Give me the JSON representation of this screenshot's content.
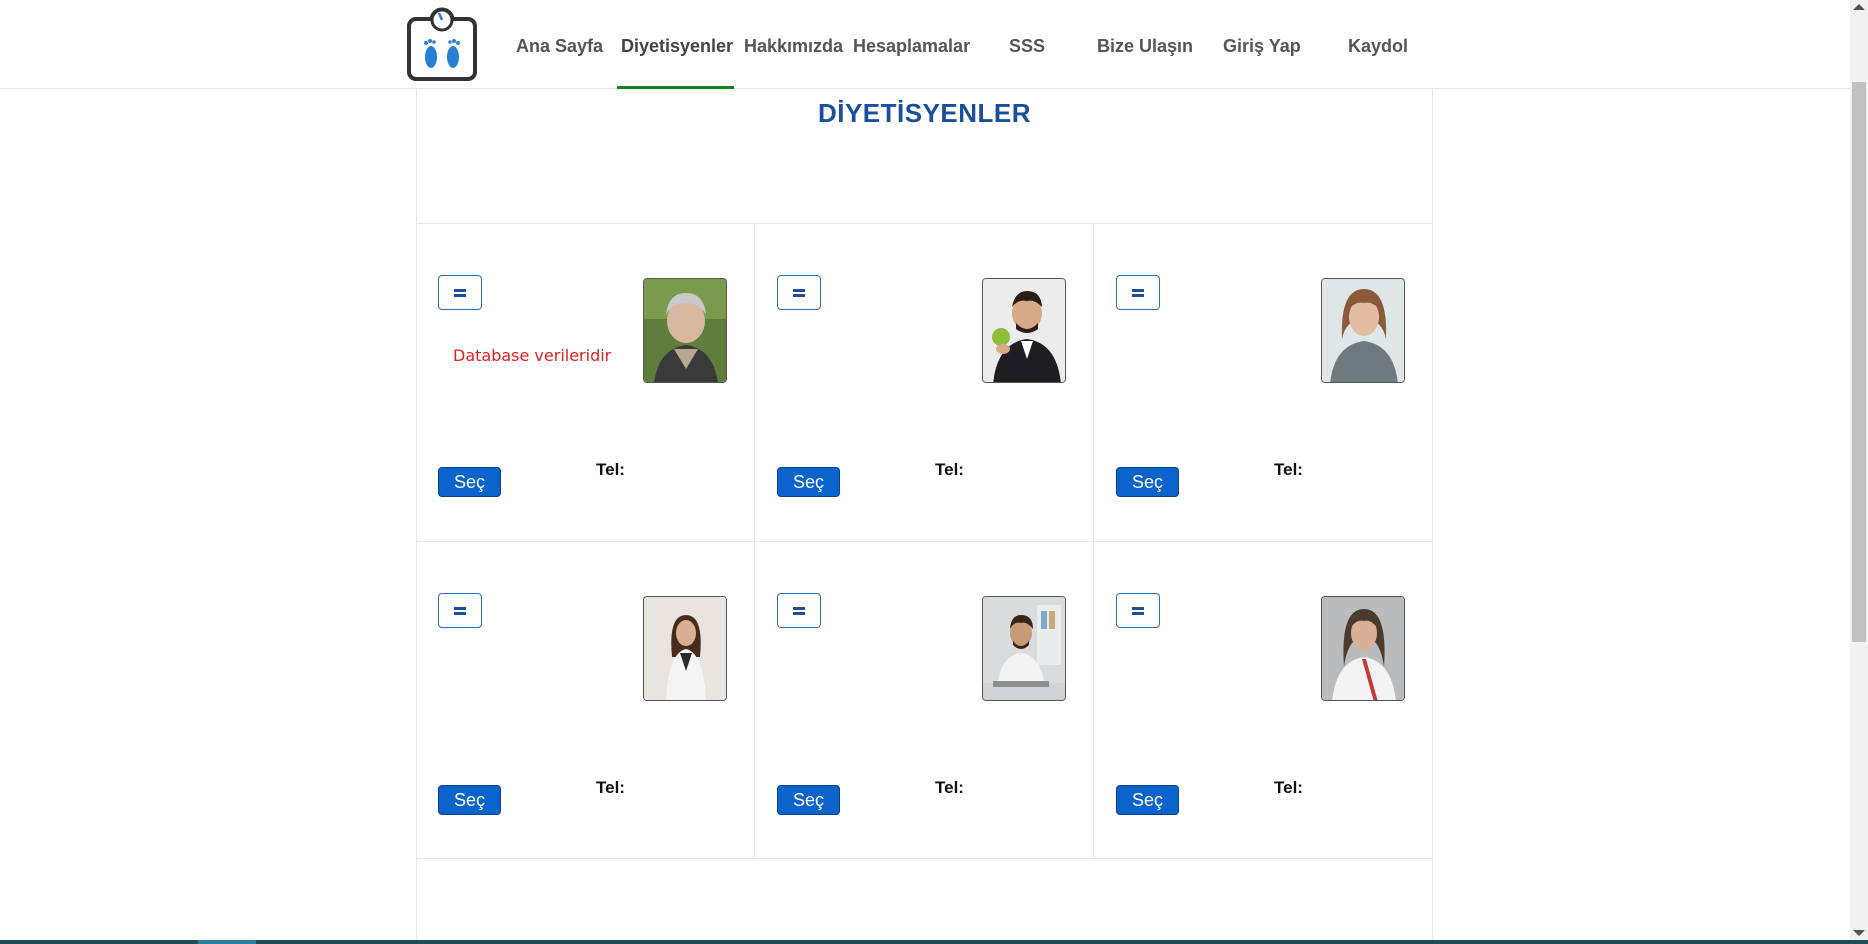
{
  "nav": {
    "items": [
      {
        "label": "Ana Sayfa",
        "key": "ana-sayfa"
      },
      {
        "label": "Diyetisyenler",
        "key": "diyetisyenler"
      },
      {
        "label": "Hakkımızda",
        "key": "hakkimizda"
      },
      {
        "label": "Hesaplamalar",
        "key": "hesaplamalar"
      },
      {
        "label": "SSS",
        "key": "sss"
      },
      {
        "label": "Bize Ulaşın",
        "key": "bize-ulasin"
      },
      {
        "label": "Giriş Yap",
        "key": "giris-yap"
      },
      {
        "label": "Kaydol",
        "key": "kaydol"
      }
    ],
    "active": "Diyetisyenler"
  },
  "logo": {
    "icon": "scale-footprints-icon"
  },
  "page": {
    "title": "DİYETİSYENLER"
  },
  "cards": [
    {
      "note": "Database verileridir",
      "select_label": "Seç",
      "tel_label": "Tel:",
      "menu_icon": "menu-icon"
    },
    {
      "select_label": "Seç",
      "tel_label": "Tel:",
      "menu_icon": "menu-icon"
    },
    {
      "select_label": "Seç",
      "tel_label": "Tel:",
      "menu_icon": "menu-icon"
    },
    {
      "select_label": "Seç",
      "tel_label": "Tel:",
      "menu_icon": "menu-icon"
    },
    {
      "select_label": "Seç",
      "tel_label": "Tel:",
      "menu_icon": "menu-icon"
    },
    {
      "select_label": "Seç",
      "tel_label": "Tel:",
      "menu_icon": "menu-icon"
    }
  ],
  "colors": {
    "title": "#1a4f9c",
    "nav_active_underline": "#15831a",
    "button": "#0a64cc",
    "note": "#e02020"
  }
}
